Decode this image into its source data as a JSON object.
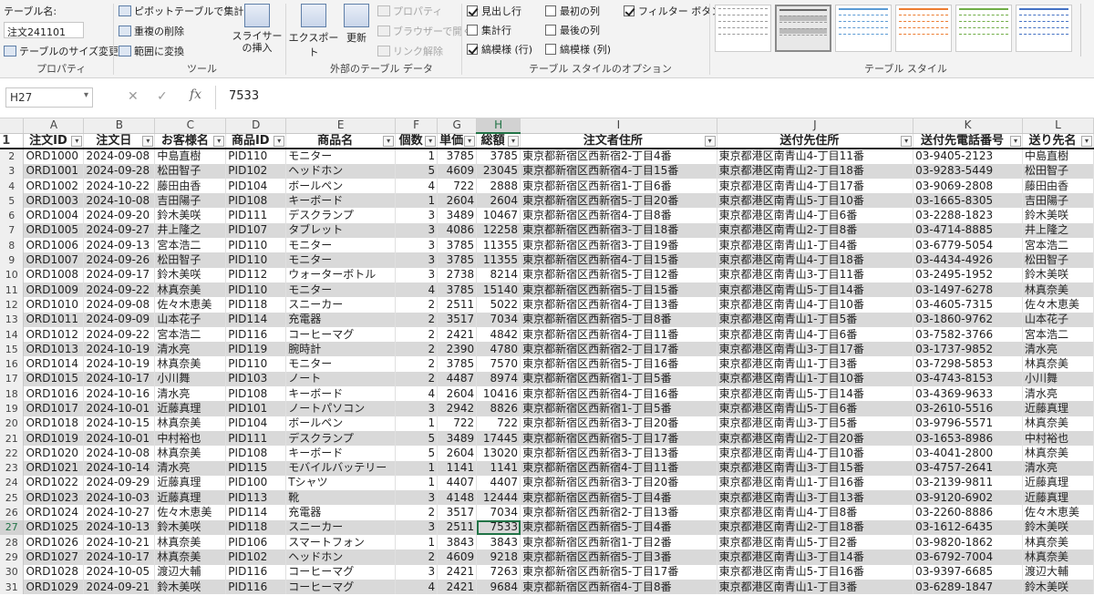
{
  "ribbon": {
    "table_name_label": "テーブル名:",
    "table_name_value": "注文241101",
    "resize_table": "テーブルのサイズ変更",
    "group_properties": "プロパティ",
    "pivot_summary": "ピボットテーブルで集計",
    "remove_duplicates": "重複の削除",
    "convert_to_range": "範囲に変換",
    "insert_slicer": "スライサーの挿入",
    "group_tools": "ツール",
    "export": "エクスポート",
    "refresh": "更新",
    "properties": "プロパティ",
    "open_in_browser": "ブラウザーで開く",
    "unlink": "リンク解除",
    "group_external": "外部のテーブル データ",
    "header_row": "見出し行",
    "total_row": "集計行",
    "banded_rows": "縞模様 (行)",
    "first_column": "最初の列",
    "last_column": "最後の列",
    "banded_columns": "縞模様 (列)",
    "filter_button": "フィルター ボタン",
    "group_style_options": "テーブル スタイルのオプション",
    "group_table_styles": "テーブル スタイル"
  },
  "formula_bar": {
    "name_box": "H27",
    "cancel": "✕",
    "enter": "✓",
    "fx": "fx",
    "value": "7533"
  },
  "columns": [
    "A",
    "B",
    "C",
    "D",
    "E",
    "F",
    "G",
    "H",
    "I",
    "J",
    "K",
    "L"
  ],
  "headers": [
    "注文ID",
    "注文日",
    "お客様名",
    "商品ID",
    "商品名",
    "個数",
    "単価",
    "総額",
    "注文者住所",
    "送付先住所",
    "送付先電話番号",
    "送り先名"
  ],
  "rows": [
    [
      "ORD1000",
      "2024-09-08",
      "中島直樹",
      "PID110",
      "モニター",
      "1",
      "3785",
      "3785",
      "東京都新宿区西新宿2-丁目4番",
      "東京都港区南青山4-丁目11番",
      "03-9405-2123",
      "中島直樹"
    ],
    [
      "ORD1001",
      "2024-09-28",
      "松田智子",
      "PID102",
      "ヘッドホン",
      "5",
      "4609",
      "23045",
      "東京都新宿区西新宿4-丁目15番",
      "東京都港区南青山2-丁目18番",
      "03-9283-5449",
      "松田智子"
    ],
    [
      "ORD1002",
      "2024-10-22",
      "藤田由香",
      "PID104",
      "ボールペン",
      "4",
      "722",
      "2888",
      "東京都新宿区西新宿1-丁目6番",
      "東京都港区南青山4-丁目17番",
      "03-9069-2808",
      "藤田由香"
    ],
    [
      "ORD1003",
      "2024-10-08",
      "吉田陽子",
      "PID108",
      "キーボード",
      "1",
      "2604",
      "2604",
      "東京都新宿区西新宿5-丁目20番",
      "東京都港区南青山5-丁目10番",
      "03-1665-8305",
      "吉田陽子"
    ],
    [
      "ORD1004",
      "2024-09-20",
      "鈴木美咲",
      "PID111",
      "デスクランプ",
      "3",
      "3489",
      "10467",
      "東京都新宿区西新宿4-丁目8番",
      "東京都港区南青山4-丁目6番",
      "03-2288-1823",
      "鈴木美咲"
    ],
    [
      "ORD1005",
      "2024-09-27",
      "井上隆之",
      "PID107",
      "タブレット",
      "3",
      "4086",
      "12258",
      "東京都新宿区西新宿3-丁目18番",
      "東京都港区南青山2-丁目8番",
      "03-4714-8885",
      "井上隆之"
    ],
    [
      "ORD1006",
      "2024-09-13",
      "宮本浩二",
      "PID110",
      "モニター",
      "3",
      "3785",
      "11355",
      "東京都新宿区西新宿3-丁目19番",
      "東京都港区南青山1-丁目4番",
      "03-6779-5054",
      "宮本浩二"
    ],
    [
      "ORD1007",
      "2024-09-26",
      "松田智子",
      "PID110",
      "モニター",
      "3",
      "3785",
      "11355",
      "東京都新宿区西新宿4-丁目15番",
      "東京都港区南青山4-丁目18番",
      "03-4434-4926",
      "松田智子"
    ],
    [
      "ORD1008",
      "2024-09-17",
      "鈴木美咲",
      "PID112",
      "ウォーターボトル",
      "3",
      "2738",
      "8214",
      "東京都新宿区西新宿5-丁目12番",
      "東京都港区南青山3-丁目11番",
      "03-2495-1952",
      "鈴木美咲"
    ],
    [
      "ORD1009",
      "2024-09-22",
      "林真奈美",
      "PID110",
      "モニター",
      "4",
      "3785",
      "15140",
      "東京都新宿区西新宿5-丁目15番",
      "東京都港区南青山5-丁目14番",
      "03-1497-6278",
      "林真奈美"
    ],
    [
      "ORD1010",
      "2024-09-08",
      "佐々木恵美",
      "PID118",
      "スニーカー",
      "2",
      "2511",
      "5022",
      "東京都新宿区西新宿4-丁目13番",
      "東京都港区南青山4-丁目10番",
      "03-4605-7315",
      "佐々木恵美"
    ],
    [
      "ORD1011",
      "2024-09-09",
      "山本花子",
      "PID114",
      "充電器",
      "2",
      "3517",
      "7034",
      "東京都新宿区西新宿5-丁目8番",
      "東京都港区南青山1-丁目5番",
      "03-1860-9762",
      "山本花子"
    ],
    [
      "ORD1012",
      "2024-09-22",
      "宮本浩二",
      "PID116",
      "コーヒーマグ",
      "2",
      "2421",
      "4842",
      "東京都新宿区西新宿4-丁目11番",
      "東京都港区南青山4-丁目6番",
      "03-7582-3766",
      "宮本浩二"
    ],
    [
      "ORD1013",
      "2024-10-19",
      "清水亮",
      "PID119",
      "腕時計",
      "2",
      "2390",
      "4780",
      "東京都新宿区西新宿2-丁目17番",
      "東京都港区南青山3-丁目17番",
      "03-1737-9852",
      "清水亮"
    ],
    [
      "ORD1014",
      "2024-10-19",
      "林真奈美",
      "PID110",
      "モニター",
      "2",
      "3785",
      "7570",
      "東京都新宿区西新宿5-丁目16番",
      "東京都港区南青山1-丁目3番",
      "03-7298-5853",
      "林真奈美"
    ],
    [
      "ORD1015",
      "2024-10-17",
      "小川舞",
      "PID103",
      "ノート",
      "2",
      "4487",
      "8974",
      "東京都新宿区西新宿1-丁目5番",
      "東京都港区南青山1-丁目10番",
      "03-4743-8153",
      "小川舞"
    ],
    [
      "ORD1016",
      "2024-10-16",
      "清水亮",
      "PID108",
      "キーボード",
      "4",
      "2604",
      "10416",
      "東京都新宿区西新宿4-丁目16番",
      "東京都港区南青山5-丁目14番",
      "03-4369-9633",
      "清水亮"
    ],
    [
      "ORD1017",
      "2024-10-01",
      "近藤真理",
      "PID101",
      "ノートパソコン",
      "3",
      "2942",
      "8826",
      "東京都新宿区西新宿1-丁目5番",
      "東京都港区南青山5-丁目6番",
      "03-2610-5516",
      "近藤真理"
    ],
    [
      "ORD1018",
      "2024-10-15",
      "林真奈美",
      "PID104",
      "ボールペン",
      "1",
      "722",
      "722",
      "東京都新宿区西新宿3-丁目20番",
      "東京都港区南青山3-丁目5番",
      "03-9796-5571",
      "林真奈美"
    ],
    [
      "ORD1019",
      "2024-10-01",
      "中村裕也",
      "PID111",
      "デスクランプ",
      "5",
      "3489",
      "17445",
      "東京都新宿区西新宿5-丁目17番",
      "東京都港区南青山2-丁目20番",
      "03-1653-8986",
      "中村裕也"
    ],
    [
      "ORD1020",
      "2024-10-08",
      "林真奈美",
      "PID108",
      "キーボード",
      "5",
      "2604",
      "13020",
      "東京都新宿区西新宿3-丁目13番",
      "東京都港区南青山4-丁目10番",
      "03-4041-2800",
      "林真奈美"
    ],
    [
      "ORD1021",
      "2024-10-14",
      "清水亮",
      "PID115",
      "モバイルバッテリー",
      "1",
      "1141",
      "1141",
      "東京都新宿区西新宿4-丁目11番",
      "東京都港区南青山3-丁目15番",
      "03-4757-2641",
      "清水亮"
    ],
    [
      "ORD1022",
      "2024-09-29",
      "近藤真理",
      "PID100",
      "Tシャツ",
      "1",
      "4407",
      "4407",
      "東京都新宿区西新宿3-丁目20番",
      "東京都港区南青山1-丁目16番",
      "03-2139-9811",
      "近藤真理"
    ],
    [
      "ORD1023",
      "2024-10-03",
      "近藤真理",
      "PID113",
      "靴",
      "3",
      "4148",
      "12444",
      "東京都新宿区西新宿5-丁目4番",
      "東京都港区南青山3-丁目13番",
      "03-9120-6902",
      "近藤真理"
    ],
    [
      "ORD1024",
      "2024-10-27",
      "佐々木恵美",
      "PID114",
      "充電器",
      "2",
      "3517",
      "7034",
      "東京都新宿区西新宿2-丁目13番",
      "東京都港区南青山4-丁目8番",
      "03-2260-8886",
      "佐々木恵美"
    ],
    [
      "ORD1025",
      "2024-10-13",
      "鈴木美咲",
      "PID118",
      "スニーカー",
      "3",
      "2511",
      "7533",
      "東京都新宿区西新宿5-丁目4番",
      "東京都港区南青山2-丁目18番",
      "03-1612-6435",
      "鈴木美咲"
    ],
    [
      "ORD1026",
      "2024-10-21",
      "林真奈美",
      "PID106",
      "スマートフォン",
      "1",
      "3843",
      "3843",
      "東京都新宿区西新宿1-丁目2番",
      "東京都港区南青山5-丁目2番",
      "03-9820-1862",
      "林真奈美"
    ],
    [
      "ORD1027",
      "2024-10-17",
      "林真奈美",
      "PID102",
      "ヘッドホン",
      "2",
      "4609",
      "9218",
      "東京都新宿区西新宿5-丁目3番",
      "東京都港区南青山3-丁目14番",
      "03-6792-7004",
      "林真奈美"
    ],
    [
      "ORD1028",
      "2024-10-05",
      "渡辺大輔",
      "PID116",
      "コーヒーマグ",
      "3",
      "2421",
      "7263",
      "東京都新宿区西新宿5-丁目17番",
      "東京都港区南青山5-丁目16番",
      "03-9397-6685",
      "渡辺大輔"
    ],
    [
      "ORD1029",
      "2024-09-21",
      "鈴木美咲",
      "PID116",
      "コーヒーマグ",
      "4",
      "2421",
      "9684",
      "東京都新宿区西新宿4-丁目8番",
      "東京都港区南青山1-丁目3番",
      "03-6289-1847",
      "鈴木美咲"
    ]
  ],
  "active_cell": {
    "row": 27,
    "col": "H"
  }
}
